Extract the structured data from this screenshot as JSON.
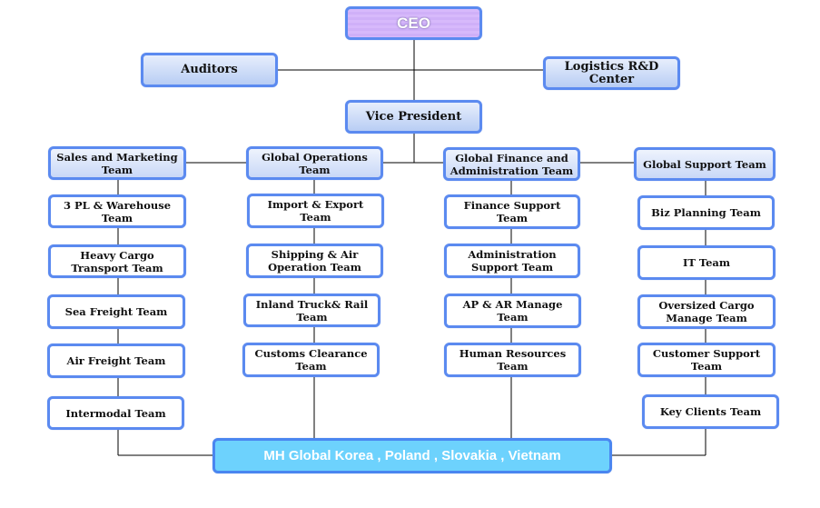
{
  "chart": {
    "ceo": "CEO",
    "auditors": "Auditors",
    "rnd_center": "Logistics R&D Center",
    "vice_president": "Vice President",
    "divisions": [
      {
        "name": "Sales and Marketing Team",
        "teams": [
          "3 PL & Warehouse Team",
          "Heavy Cargo Transport Team",
          "Sea Freight Team",
          "Air Freight Team",
          "Intermodal Team"
        ]
      },
      {
        "name": "Global Operations Team",
        "teams": [
          "Import & Export Team",
          "Shipping & Air Operation Team",
          "Inland Truck& Rail Team",
          "Customs Clearance Team"
        ]
      },
      {
        "name": "Global Finance and Administration Team",
        "teams": [
          "Finance Support Team",
          "Administration Support Team",
          "AP & AR Manage Team",
          "Human Resources Team"
        ]
      },
      {
        "name": "Global Support Team",
        "teams": [
          "Biz Planning Team",
          "IT Team",
          "Oversized Cargo Manage Team",
          "Customer Support Team",
          "Key Clients Team"
        ]
      }
    ],
    "subsidiaries": "MH Global Korea , Poland , Slovakia , Vietnam"
  },
  "colors": {
    "border": "#5b8af0",
    "ceo_fill": "#d7b9fb",
    "footer_fill": "#6dd2fd",
    "line": "#000000"
  }
}
